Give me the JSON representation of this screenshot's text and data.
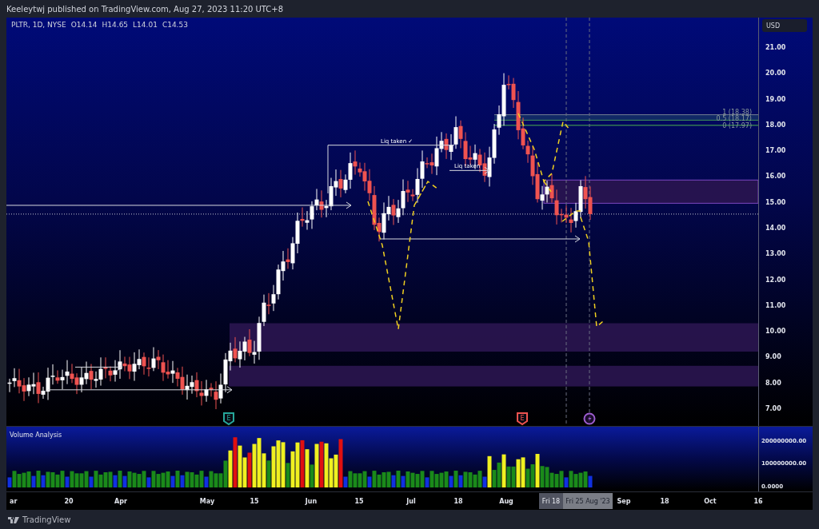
{
  "header": {
    "text": "Keeleytwj published on TradingView.com, Aug 27, 2023 11:20 UTC+8"
  },
  "legend": {
    "symbol": "PLTR, 1D, NYSE",
    "values": [
      "O14.14",
      "H14.65",
      "L14.01",
      "C14.53"
    ]
  },
  "price_axis": {
    "currency_button": "USD",
    "labels": [
      "21.00",
      "20.00",
      "19.00",
      "18.00",
      "17.00",
      "16.00",
      "15.00",
      "14.00",
      "13.00",
      "12.00",
      "11.00",
      "10.00",
      "9.00",
      "8.00",
      "7.00"
    ]
  },
  "annotations": [
    {
      "kind": "label",
      "text": "Liq taken ✓"
    },
    {
      "kind": "label",
      "text": "Liq taken"
    }
  ],
  "fib_levels": [
    "1 (18.38)",
    "0.5 (18.17)",
    "0 (17.97)"
  ],
  "event_markers": [
    {
      "kind": "earnings",
      "label": "E",
      "color": "#26a69a"
    },
    {
      "kind": "earnings",
      "label": "E",
      "color": "#ef5350"
    },
    {
      "kind": "flash",
      "color": "#9c5ccf"
    }
  ],
  "volume_pane": {
    "title": "Volume Analysis",
    "axis_labels": [
      "200000000.00",
      "100000000.00",
      "0.0000"
    ]
  },
  "time_axis": {
    "labels": [
      "ar",
      "20",
      "Apr",
      "May",
      "15",
      "Jun",
      "15",
      "Jul",
      "18",
      "Aug",
      "Sep",
      "18",
      "Oct",
      "16"
    ],
    "crosshair_labels": [
      "Fri 18",
      "Fri 25 Aug '23"
    ]
  },
  "footer": {
    "brand": "TradingView"
  }
}
